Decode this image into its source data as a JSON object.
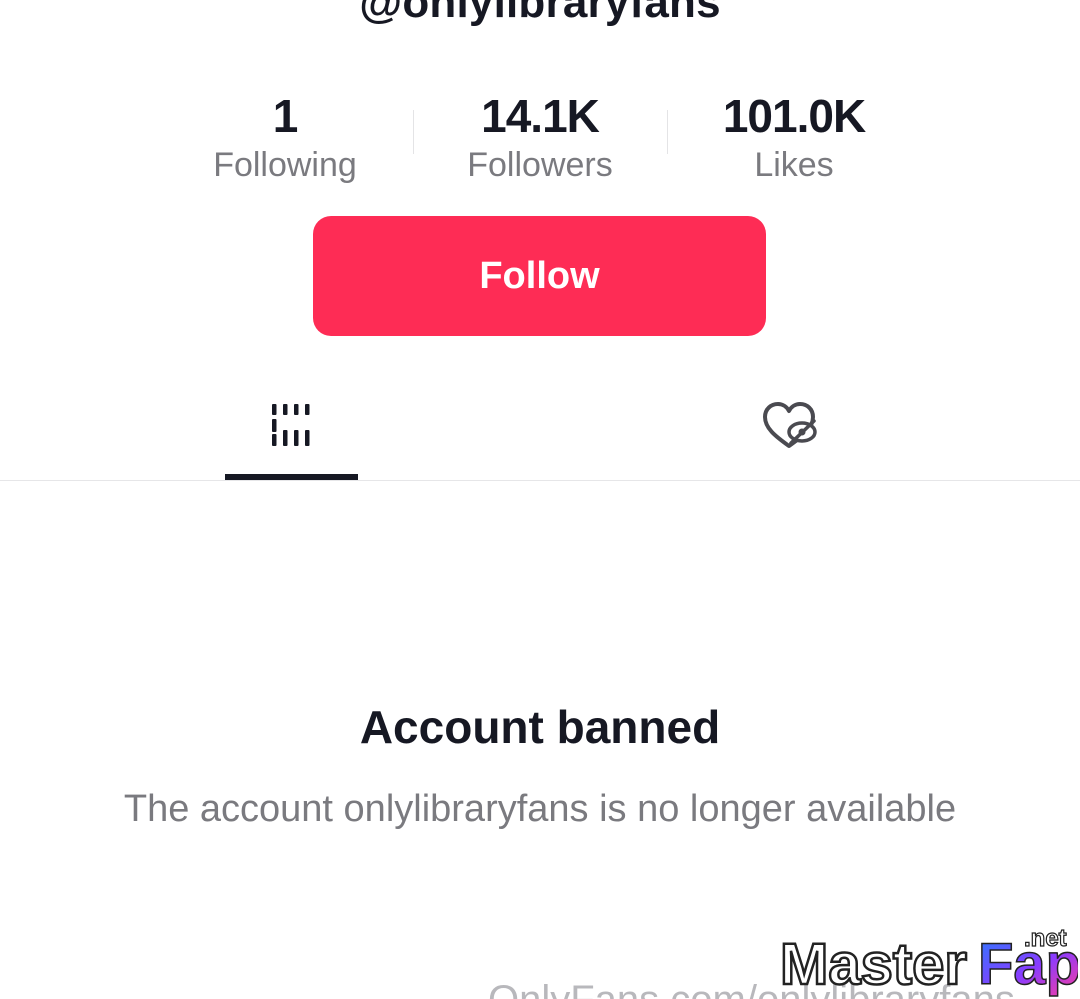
{
  "profile": {
    "username": "@onlylibraryfans"
  },
  "stats": [
    {
      "value": "1",
      "label": "Following"
    },
    {
      "value": "14.1K",
      "label": "Followers"
    },
    {
      "value": "101.0K",
      "label": "Likes"
    }
  ],
  "actions": {
    "follow_label": "Follow"
  },
  "tabs": {
    "videos_icon": "grid-icon",
    "liked_icon": "hidden-liked-heart-icon",
    "active": "videos"
  },
  "status": {
    "title": "Account banned",
    "description": "The account onlylibraryfans is no longer available"
  },
  "footer": {
    "url_text": "OnlyFans.com/onlylibraryfans"
  },
  "watermark": {
    "text_master": "Master",
    "text_fap": "Fap",
    "text_net": ".net"
  },
  "colors": {
    "accent": "#fe2c55",
    "text_primary": "#161823",
    "text_secondary": "#7a7a7f"
  }
}
